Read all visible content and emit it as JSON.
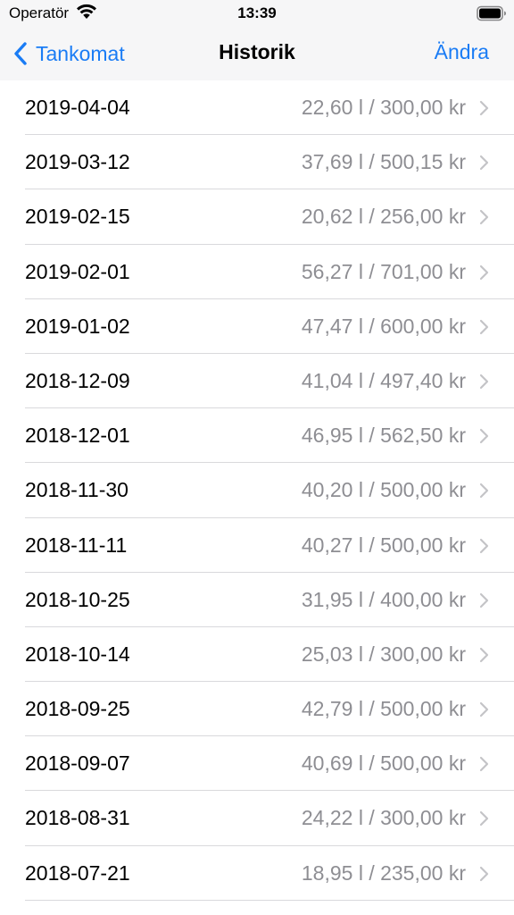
{
  "status_bar": {
    "carrier": "Operatör",
    "time": "13:39"
  },
  "nav": {
    "back_label": "Tankomat",
    "title": "Historik",
    "edit_label": "Ändra"
  },
  "colors": {
    "accent": "#1a7cf5",
    "detail_text": "#8e8e93",
    "separator": "#d9d9dc",
    "chevron": "#c4c4c7"
  },
  "icons": {
    "back": "chevron-left-icon",
    "disclosure": "chevron-right-icon",
    "wifi": "wifi-icon",
    "battery": "battery-icon"
  },
  "entries": [
    {
      "date": "2019-04-04",
      "detail": "22,60 l / 300,00 kr"
    },
    {
      "date": "2019-03-12",
      "detail": "37,69 l / 500,15 kr"
    },
    {
      "date": "2019-02-15",
      "detail": "20,62 l / 256,00 kr"
    },
    {
      "date": "2019-02-01",
      "detail": "56,27 l / 701,00 kr"
    },
    {
      "date": "2019-01-02",
      "detail": "47,47 l / 600,00 kr"
    },
    {
      "date": "2018-12-09",
      "detail": "41,04 l / 497,40 kr"
    },
    {
      "date": "2018-12-01",
      "detail": "46,95 l / 562,50 kr"
    },
    {
      "date": "2018-11-30",
      "detail": "40,20 l / 500,00 kr"
    },
    {
      "date": "2018-11-11",
      "detail": "40,27 l / 500,00 kr"
    },
    {
      "date": "2018-10-25",
      "detail": "31,95 l / 400,00 kr"
    },
    {
      "date": "2018-10-14",
      "detail": "25,03 l / 300,00 kr"
    },
    {
      "date": "2018-09-25",
      "detail": "42,79 l / 500,00 kr"
    },
    {
      "date": "2018-09-07",
      "detail": "40,69 l / 500,00 kr"
    },
    {
      "date": "2018-08-31",
      "detail": "24,22 l / 300,00 kr"
    },
    {
      "date": "2018-07-21",
      "detail": "18,95 l / 235,00 kr"
    }
  ]
}
